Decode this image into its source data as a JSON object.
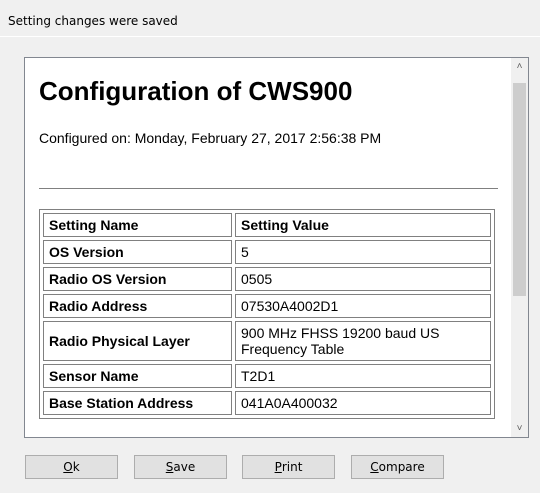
{
  "dialog": {
    "title": "Setting changes were saved"
  },
  "report": {
    "title": "Configuration of CWS900",
    "configured_on": "Configured on: Monday, February 27, 2017 2:56:38 PM",
    "table": {
      "headers": [
        "Setting Name",
        "Setting Value"
      ],
      "rows": [
        {
          "name": "OS Version",
          "value": "5"
        },
        {
          "name": "Radio OS Version",
          "value": "0505"
        },
        {
          "name": "Radio Address",
          "value": "07530A4002D1"
        },
        {
          "name": "Radio Physical Layer",
          "value": "900 MHz FHSS 19200 baud US Frequency Table"
        },
        {
          "name": "Sensor Name",
          "value": "T2D1"
        },
        {
          "name": "Base Station Address",
          "value": "041A0A400032"
        }
      ]
    }
  },
  "buttons": {
    "ok": {
      "mnemonic": "O",
      "rest": "k"
    },
    "save": {
      "mnemonic": "S",
      "rest": "ave"
    },
    "print": {
      "mnemonic": "P",
      "rest": "rint"
    },
    "compare": {
      "mnemonic": "C",
      "rest": "ompare"
    }
  },
  "icons": {
    "scroll_up": "chevron-up-icon",
    "scroll_down": "chevron-down-icon"
  }
}
